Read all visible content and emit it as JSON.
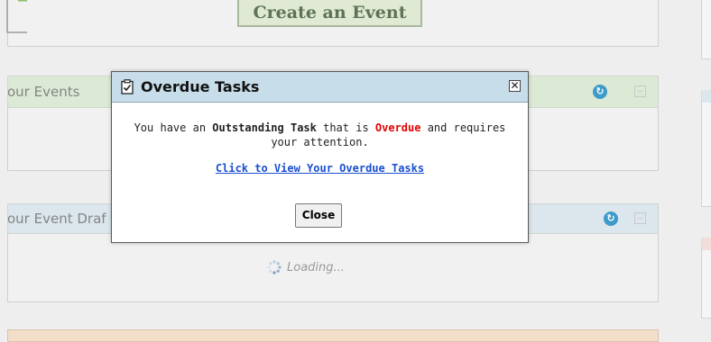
{
  "header": {
    "create_event_label": "Create an Event"
  },
  "panels": {
    "your_events": {
      "title": "our Events"
    },
    "event_drafts": {
      "title": "our Event Draf",
      "loading_text": "Loading..."
    }
  },
  "modal": {
    "title": "Overdue Tasks",
    "message": {
      "part1": "You have an ",
      "bold1": "Outstanding Task",
      "part2": " that is ",
      "overdue": "Overdue",
      "part3": " and requires your attention."
    },
    "link_text": "Click to View Your Overdue Tasks",
    "close_button": "Close"
  },
  "colors": {
    "accent_blue": "#3d9bc9",
    "overdue_red": "#e60000",
    "link_blue": "#1b4fd0",
    "modal_header": "#c7dde9"
  }
}
